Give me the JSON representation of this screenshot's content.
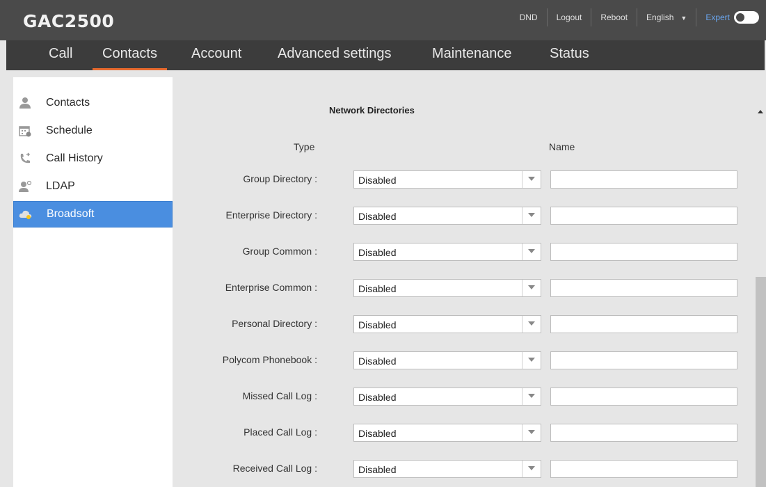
{
  "app": {
    "title": "GAC2500"
  },
  "top_links": {
    "dnd": "DND",
    "logout": "Logout",
    "reboot": "Reboot",
    "language": "English",
    "expert": "Expert"
  },
  "nav": {
    "tabs": [
      "Call",
      "Contacts",
      "Account",
      "Advanced settings",
      "Maintenance",
      "Status"
    ],
    "active": "Contacts"
  },
  "sidebar": {
    "items": [
      {
        "label": "Contacts",
        "icon": "person-icon"
      },
      {
        "label": "Schedule",
        "icon": "calendar-icon"
      },
      {
        "label": "Call History",
        "icon": "phone-history-icon"
      },
      {
        "label": "LDAP",
        "icon": "ldap-user-icon"
      },
      {
        "label": "Broadsoft",
        "icon": "cloud-icon"
      }
    ],
    "active": "Broadsoft"
  },
  "section": {
    "title": "Network Directories",
    "col_type": "Type",
    "col_name": "Name",
    "rows": [
      {
        "label": "Group Directory :",
        "value": "Disabled",
        "name": ""
      },
      {
        "label": "Enterprise Directory :",
        "value": "Disabled",
        "name": ""
      },
      {
        "label": "Group Common :",
        "value": "Disabled",
        "name": ""
      },
      {
        "label": "Enterprise Common :",
        "value": "Disabled",
        "name": ""
      },
      {
        "label": "Personal Directory :",
        "value": "Disabled",
        "name": ""
      },
      {
        "label": "Polycom Phonebook :",
        "value": "Disabled",
        "name": ""
      },
      {
        "label": "Missed Call Log :",
        "value": "Disabled",
        "name": ""
      },
      {
        "label": "Placed Call Log :",
        "value": "Disabled",
        "name": ""
      },
      {
        "label": "Received Call Log :",
        "value": "Disabled",
        "name": ""
      }
    ]
  },
  "colors": {
    "accent": "#e86a2e",
    "active_item": "#4a8ee0",
    "expert": "#6aa6ef"
  }
}
